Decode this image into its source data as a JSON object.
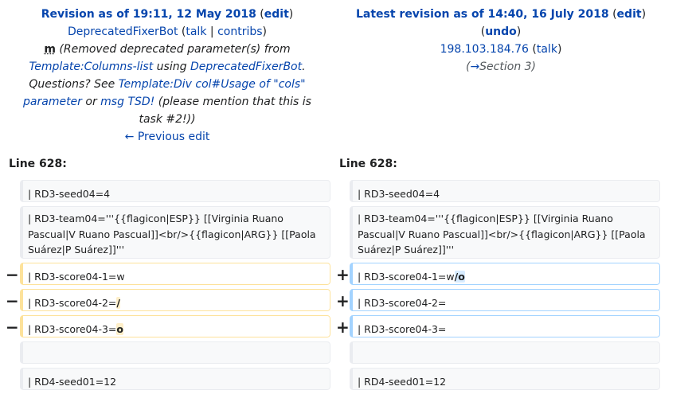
{
  "left_header": {
    "title_prefix": "Revision as of 19:11, 12 May 2018",
    "edit_paren_open": " (",
    "edit_label": "edit",
    "edit_paren_close": ")",
    "user": "DeprecatedFixerBot",
    "talk": "talk",
    "separator": " | ",
    "contribs": "contribs",
    "minor_marker": "m",
    "summary_part1": " (Removed deprecated parameter(s) from ",
    "summary_link1": "Template:Columns-list",
    "summary_part2": " using ",
    "summary_link2": "DeprecatedFixerBot",
    "summary_part3": ". Questions? See ",
    "summary_link3": "Template:Div col#Usage of \"cols\" parameter",
    "summary_part4": " or ",
    "summary_link4": "msg TSD!",
    "summary_part5": " (please mention that this is task #2!))",
    "prev_edit": "← Previous edit"
  },
  "right_header": {
    "title_prefix": "Latest revision as of 14:40, 16 July 2018",
    "edit_label": "edit",
    "undo_label": "undo",
    "user": "198.103.184.76",
    "talk": "talk",
    "section_arrow": "→",
    "section": "Section 3"
  },
  "line_labels": {
    "left": "Line 628:",
    "right": "Line 628:"
  },
  "diff_rows": [
    {
      "type": "context",
      "left": "| RD3-seed04=4",
      "right": "| RD3-seed04=4"
    },
    {
      "type": "context",
      "left_lines": [
        "| RD3-team04='''{{flagicon|ESP}} [[Virginia Ruano",
        "Pascual|V Ruano Pascual]]<br/>{{flagicon|ARG}} [[Paola",
        "Suárez|P Suárez]]'''"
      ],
      "right_lines": [
        "| RD3-team04='''{{flagicon|ESP}} [[Virginia Ruano",
        "Pascual|V Ruano Pascual]]<br/>{{flagicon|ARG}} [[Paola",
        "Suárez|P Suárez]]'''"
      ]
    },
    {
      "type": "change",
      "minus": "−",
      "plus": "+",
      "left_text": "| RD3-score04-1=w",
      "left_hl": "",
      "right_text": "| RD3-score04-1=w",
      "right_hl": "/o"
    },
    {
      "type": "change",
      "minus": "−",
      "plus": "+",
      "left_text": "| RD3-score04-2=",
      "left_hl": "/",
      "right_text": "| RD3-score04-2=",
      "right_hl": ""
    },
    {
      "type": "change",
      "minus": "−",
      "plus": "+",
      "left_text": "| RD3-score04-3=",
      "left_hl": "o",
      "right_text": "| RD3-score04-3=",
      "right_hl": ""
    },
    {
      "type": "context",
      "left": "",
      "right": ""
    },
    {
      "type": "context",
      "left": "| RD4-seed01=12",
      "right": "| RD4-seed01=12"
    }
  ],
  "colors": {
    "link": "#0645ad",
    "deleted_border": "#fde29b",
    "added_border": "#a3d3ff",
    "deleted_hl": "#feeec8",
    "added_hl": "#d8ecff"
  }
}
